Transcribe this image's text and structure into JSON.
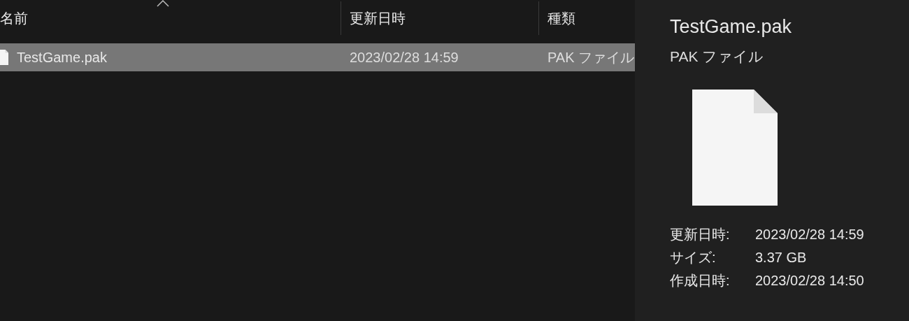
{
  "columns": [
    {
      "label": "名前",
      "sorted": true
    },
    {
      "label": "更新日時",
      "sorted": false
    },
    {
      "label": "種類",
      "sorted": false
    }
  ],
  "rows": [
    {
      "name": "TestGame.pak",
      "modified": "2023/02/28 14:59",
      "type": "PAK ファイル",
      "selected": true
    }
  ],
  "preview": {
    "title": "TestGame.pak",
    "subtitle": "PAK ファイル",
    "details": [
      {
        "label": "更新日時:",
        "value": "2023/02/28 14:59"
      },
      {
        "label": "サイズ:",
        "value": "3.37 GB"
      },
      {
        "label": "作成日時:",
        "value": "2023/02/28 14:50"
      }
    ]
  }
}
